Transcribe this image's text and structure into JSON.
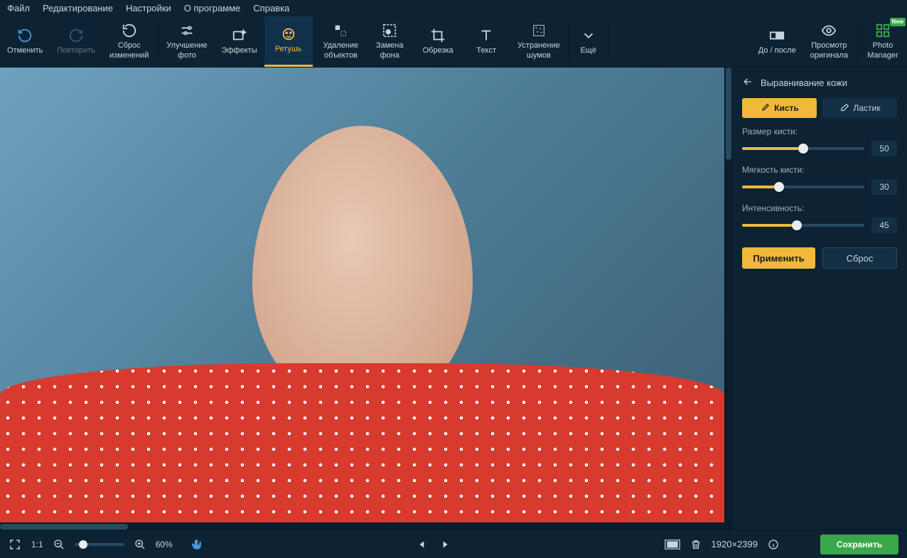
{
  "menu": {
    "file": "Файл",
    "edit": "Редактирование",
    "settings": "Настройки",
    "about": "О программе",
    "help": "Справка"
  },
  "toolbar": {
    "undo": "Отменить",
    "redo": "Повторить",
    "reset": "Сброс\nизменений",
    "enhance": "Улучшение\nфото",
    "effects": "Эффекты",
    "retouch": "Ретушь",
    "remove_objects": "Удаление\nобъектов",
    "replace_bg": "Замена\nфона",
    "crop": "Обрезка",
    "text": "Текст",
    "denoise": "Устранение\nшумов",
    "more": "Ещё",
    "before_after": "До / после",
    "view_original": "Просмотр\nоригинала",
    "photo_manager": "Photo\nManager",
    "new_badge": "New"
  },
  "panel": {
    "title": "Выравнивание кожи",
    "brush": "Кисть",
    "eraser": "Ластик",
    "sliders": {
      "size": {
        "label": "Размер кисти:",
        "value": "50",
        "pct": 50
      },
      "softness": {
        "label": "Мягкость кисти:",
        "value": "30",
        "pct": 30
      },
      "intensity": {
        "label": "Интенсивность:",
        "value": "45",
        "pct": 45
      }
    },
    "apply": "Применить",
    "reset": "Сброс"
  },
  "bottom": {
    "fit": "1:1",
    "zoom_pct": "60%",
    "dimensions": "1920×2399",
    "save": "Сохранить"
  }
}
